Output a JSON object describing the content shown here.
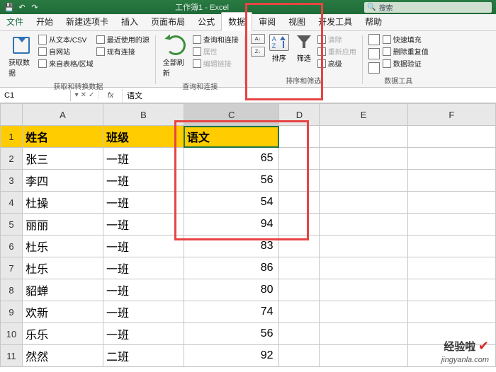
{
  "titlebar": {
    "doc_title": "工作簿1 - Excel",
    "search_placeholder": "搜索"
  },
  "menu": {
    "file": "文件",
    "home": "开始",
    "new_tab": "新建选项卡",
    "insert": "插入",
    "page_layout": "页面布局",
    "formulas": "公式",
    "data": "数据",
    "review": "审阅",
    "view": "视图",
    "developer": "开发工具",
    "help": "帮助"
  },
  "ribbon": {
    "get_data": "获取数据",
    "from_csv": "从文本/CSV",
    "from_web": "自网站",
    "from_table": "来自表格/区域",
    "recent_sources": "最近使用的源",
    "existing_conn": "现有连接",
    "group1_label": "获取和转换数据",
    "refresh_all": "全部刷新",
    "queries": "查询和连接",
    "properties": "属性",
    "edit_links": "编辑链接",
    "group2_label": "查询和连接",
    "sort": "排序",
    "filter": "筛选",
    "clear": "清除",
    "reapply": "重新应用",
    "advanced": "高级",
    "group3_label": "排序和筛选",
    "flash_fill": "快速填充",
    "remove_dup": "删除重复值",
    "data_valid": "数据验证",
    "group4_label": "数据工具"
  },
  "namebox": {
    "cell": "C1",
    "fx": "fx",
    "formula": "语文"
  },
  "sheet": {
    "columns": [
      "A",
      "B",
      "C",
      "D",
      "E",
      "F"
    ],
    "headers": {
      "name": "姓名",
      "class": "班级",
      "subject": "语文"
    },
    "rows": [
      {
        "n": 2,
        "name": "张三",
        "class": "一班",
        "val": "65"
      },
      {
        "n": 3,
        "name": "李四",
        "class": "一班",
        "val": "56"
      },
      {
        "n": 4,
        "name": "杜操",
        "class": "一班",
        "val": "54"
      },
      {
        "n": 5,
        "name": "丽丽",
        "class": "一班",
        "val": "94"
      },
      {
        "n": 6,
        "name": "杜乐",
        "class": "一班",
        "val": "83"
      },
      {
        "n": 7,
        "name": "杜乐",
        "class": "一班",
        "val": "86"
      },
      {
        "n": 8,
        "name": "貂蝉",
        "class": "一班",
        "val": "80"
      },
      {
        "n": 9,
        "name": "欢新",
        "class": "一班",
        "val": "74"
      },
      {
        "n": 10,
        "name": "乐乐",
        "class": "一班",
        "val": "56"
      },
      {
        "n": 11,
        "name": "然然",
        "class": "二班",
        "val": "92"
      }
    ]
  },
  "watermark": {
    "brand": "经验啦",
    "url": "jingyanla.com"
  }
}
